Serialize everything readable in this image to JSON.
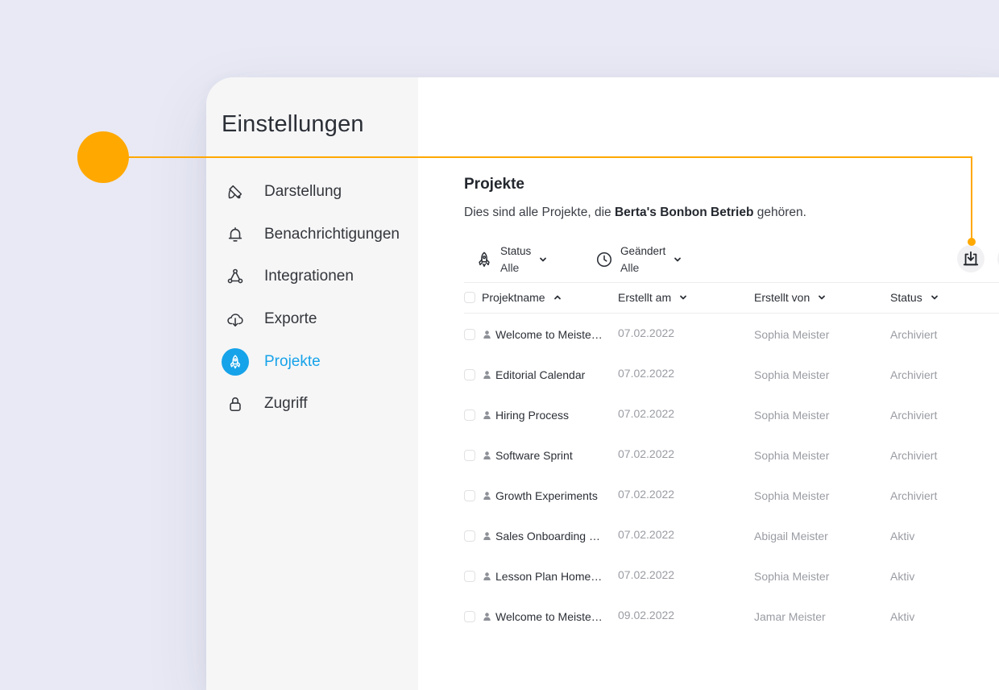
{
  "colors": {
    "accent": "#16a3e9",
    "callout": "#ffa800",
    "background": "#e8e9f4",
    "muted_text": "#9a9ca3"
  },
  "sidebar": {
    "title": "Einstellungen",
    "items": [
      {
        "label": "Darstellung",
        "icon": "paint-brush-icon",
        "active": false
      },
      {
        "label": "Benachrichtigungen",
        "icon": "bell-icon",
        "active": false
      },
      {
        "label": "Integrationen",
        "icon": "network-icon",
        "active": false
      },
      {
        "label": "Exporte",
        "icon": "cloud-download-icon",
        "active": false
      },
      {
        "label": "Projekte",
        "icon": "rocket-icon",
        "active": true
      },
      {
        "label": "Zugriff",
        "icon": "lock-icon",
        "active": false
      }
    ]
  },
  "main": {
    "title": "Projekte",
    "subtitle_prefix": "Dies sind alle Projekte, die ",
    "subtitle_org": "Berta's Bonbon Betrieb",
    "subtitle_suffix": " gehören.",
    "filters": [
      {
        "label": "Status",
        "value": "Alle",
        "icon": "rocket-icon"
      },
      {
        "label": "Geändert",
        "value": "Alle",
        "icon": "clock-icon"
      }
    ],
    "export_icon": "export-download-icon"
  },
  "table": {
    "columns": [
      {
        "label": "Projektname",
        "sort": "asc"
      },
      {
        "label": "Erstellt am",
        "sort": "none"
      },
      {
        "label": "Erstellt von",
        "sort": "none"
      },
      {
        "label": "Status",
        "sort": "none"
      }
    ],
    "rows": [
      {
        "name": "Welcome to Meister for Teams",
        "created": "07.02.2022",
        "author": "Sophia Meister",
        "status": "Archiviert"
      },
      {
        "name": "Editorial Calendar",
        "created": "07.02.2022",
        "author": "Sophia Meister",
        "status": "Archiviert"
      },
      {
        "name": "Hiring Process",
        "created": "07.02.2022",
        "author": "Sophia Meister",
        "status": "Archiviert"
      },
      {
        "name": "Software Sprint",
        "created": "07.02.2022",
        "author": "Sophia Meister",
        "status": "Archiviert"
      },
      {
        "name": "Growth Experiments",
        "created": "07.02.2022",
        "author": "Sophia Meister",
        "status": "Archiviert"
      },
      {
        "name": "Sales Onboarding Program",
        "created": "07.02.2022",
        "author": "Abigail Meister",
        "status": "Aktiv"
      },
      {
        "name": "Lesson Plan Homework",
        "created": "07.02.2022",
        "author": "Sophia Meister",
        "status": "Aktiv"
      },
      {
        "name": "Welcome to Meister for Teams",
        "created": "09.02.2022",
        "author": "Jamar Meister",
        "status": "Aktiv"
      }
    ]
  }
}
